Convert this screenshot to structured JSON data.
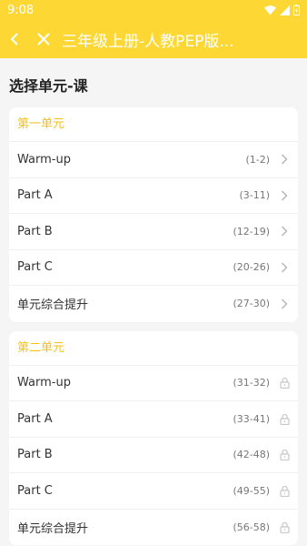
{
  "status": {
    "time": "9:08"
  },
  "header": {
    "title": "三年级上册-人教PEP版..."
  },
  "section": {
    "title": "选择单元-课"
  },
  "units": [
    {
      "title": "第一单元",
      "locked": false,
      "lessons": [
        {
          "label": "Warm-up",
          "pages": "(1-2)"
        },
        {
          "label": "Part A",
          "pages": "(3-11)"
        },
        {
          "label": "Part B",
          "pages": "(12-19)"
        },
        {
          "label": "Part C",
          "pages": "(20-26)"
        },
        {
          "label": "单元综合提升",
          "pages": "(27-30)"
        }
      ]
    },
    {
      "title": "第二单元",
      "locked": true,
      "lessons": [
        {
          "label": "Warm-up",
          "pages": "(31-32)"
        },
        {
          "label": "Part A",
          "pages": "(33-41)"
        },
        {
          "label": "Part B",
          "pages": "(42-48)"
        },
        {
          "label": "Part C",
          "pages": "(49-55)"
        },
        {
          "label": "单元综合提升",
          "pages": "(56-58)"
        }
      ]
    }
  ],
  "colors": {
    "accent": "#fdd835",
    "unit_title": "#f3c21a"
  }
}
